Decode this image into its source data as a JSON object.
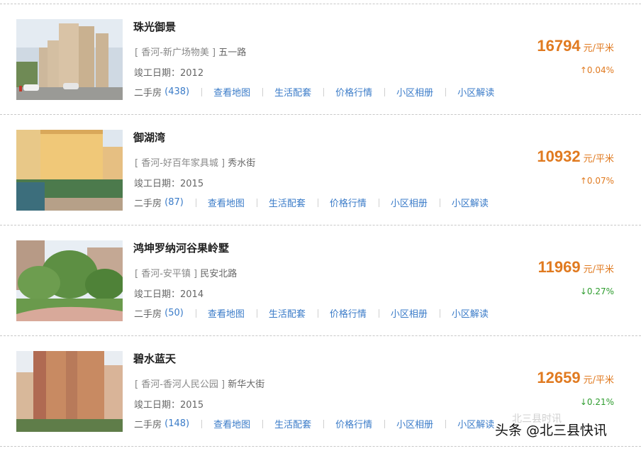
{
  "listings": [
    {
      "name": "珠光御景",
      "district": "香河-新广场物美",
      "road": "五一路",
      "built_label": "竣工日期：",
      "built_year": "2012",
      "secondhand_label": "二手房",
      "secondhand_count": "(438)",
      "links": [
        "查看地图",
        "生活配套",
        "价格行情",
        "小区相册",
        "小区解读"
      ],
      "price": "16794",
      "price_unit": "元/平米",
      "change": "↑0.04%",
      "change_direction": "up"
    },
    {
      "name": "御湖湾",
      "district": "香河-好百年家具城",
      "road": "秀水街",
      "built_label": "竣工日期：",
      "built_year": "2015",
      "secondhand_label": "二手房",
      "secondhand_count": "(87)",
      "links": [
        "查看地图",
        "生活配套",
        "价格行情",
        "小区相册",
        "小区解读"
      ],
      "price": "10932",
      "price_unit": "元/平米",
      "change": "↑0.07%",
      "change_direction": "up"
    },
    {
      "name": "鸿坤罗纳河谷果岭墅",
      "district": "香河-安平镇",
      "road": "民安北路",
      "built_label": "竣工日期：",
      "built_year": "2014",
      "secondhand_label": "二手房",
      "secondhand_count": "(50)",
      "links": [
        "查看地图",
        "生活配套",
        "价格行情",
        "小区相册",
        "小区解读"
      ],
      "price": "11969",
      "price_unit": "元/平米",
      "change": "↓0.27%",
      "change_direction": "down"
    },
    {
      "name": "碧水蓝天",
      "district": "香河-香河人民公园",
      "road": "新华大街",
      "built_label": "竣工日期：",
      "built_year": "2015",
      "secondhand_label": "二手房",
      "secondhand_count": "(148)",
      "links": [
        "查看地图",
        "生活配套",
        "价格行情",
        "小区相册",
        "小区解读"
      ],
      "price": "12659",
      "price_unit": "元/平米",
      "change": "↓0.21%",
      "change_direction": "down"
    }
  ],
  "watermark": {
    "text": "头条 @北三县快讯",
    "ghost_text": "北三县时讯"
  },
  "colors": {
    "price": "#e07a20",
    "change_up": "#e07a20",
    "change_down": "#2e9c2e",
    "link": "#3a7bc8"
  }
}
